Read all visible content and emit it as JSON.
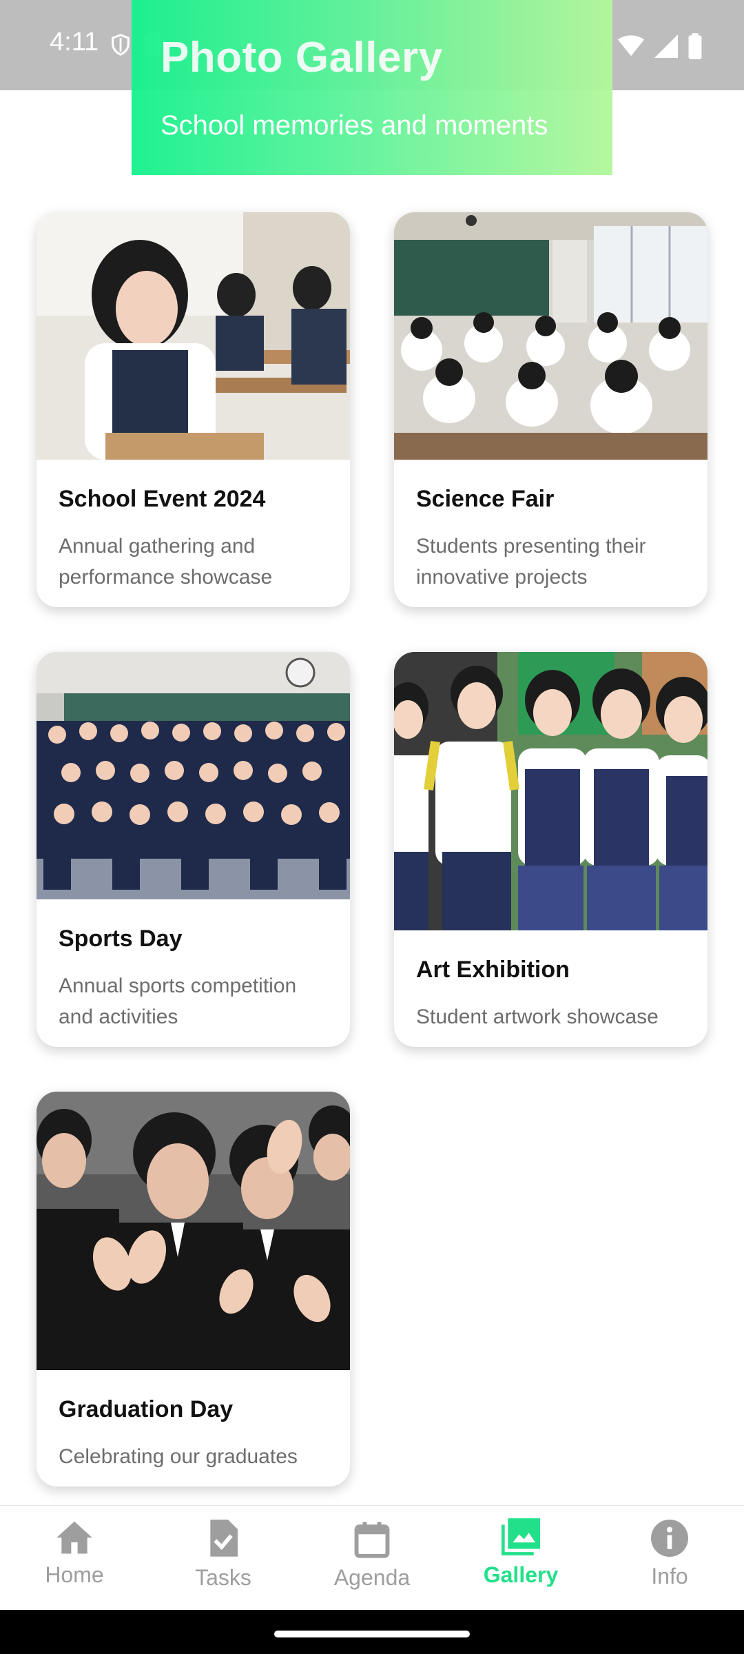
{
  "status_bar": {
    "time": "4:11",
    "icons_left": [
      "shield-icon",
      "sd-card-icon"
    ],
    "icons_right": [
      "wifi-icon",
      "signal-icon",
      "battery-icon"
    ]
  },
  "header": {
    "title": "Photo Gallery",
    "subtitle": "School memories and moments",
    "gradient_colors": [
      "#14f28c",
      "#b2f79a"
    ]
  },
  "gallery": {
    "cards": [
      {
        "title": "School Event 2024",
        "description": "Annual gathering and performance showcase",
        "image": "students-at-desks-photo"
      },
      {
        "title": "Science Fair",
        "description": "Students presenting their innovative projects",
        "image": "classroom-photo"
      },
      {
        "title": "Sports Day",
        "description": "Annual sports competition and activities",
        "image": "class-group-photo"
      },
      {
        "title": "Art Exhibition",
        "description": "Student artwork showcase",
        "image": "students-smiling-photo"
      },
      {
        "title": "Graduation Day",
        "description": "Celebrating our graduates",
        "image": "graduates-cheering-photo"
      }
    ]
  },
  "bottom_nav": {
    "items": [
      {
        "label": "Home",
        "icon": "home-icon"
      },
      {
        "label": "Tasks",
        "icon": "tasks-icon"
      },
      {
        "label": "Agenda",
        "icon": "calendar-icon"
      },
      {
        "label": "Gallery",
        "icon": "gallery-icon",
        "active": true
      },
      {
        "label": "Info",
        "icon": "info-icon"
      }
    ],
    "active_color": "#22e08a",
    "inactive_color": "#9e9e9e"
  }
}
